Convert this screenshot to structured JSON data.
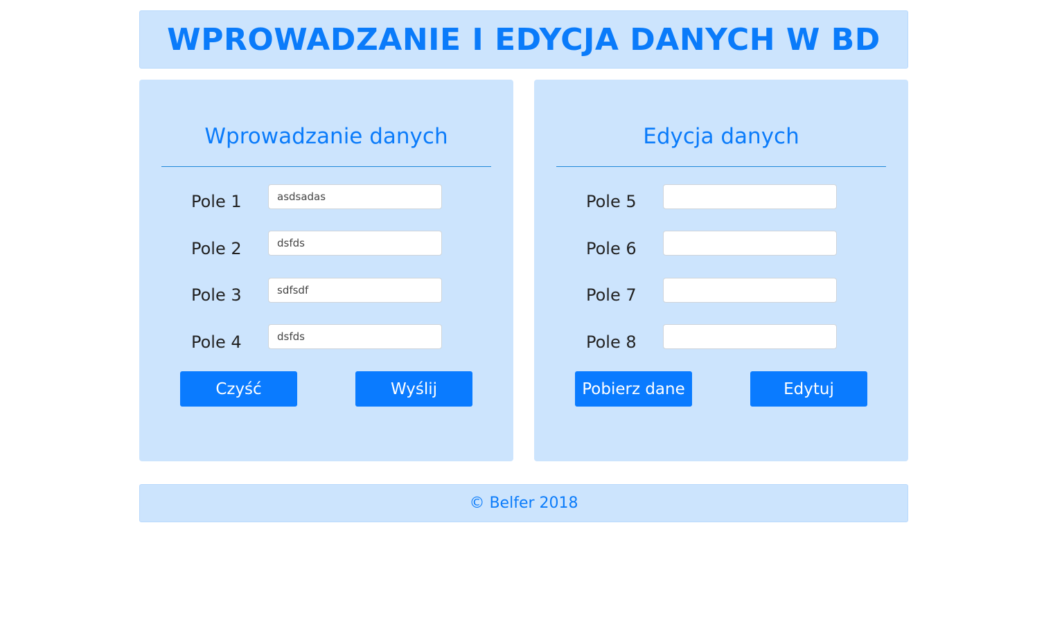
{
  "header": {
    "title": "WPROWADZANIE I EDYCJA DANYCH W BD"
  },
  "left_panel": {
    "title": "Wprowadzanie danych",
    "fields": [
      {
        "label": "Pole 1",
        "value": "asdsadas"
      },
      {
        "label": "Pole 2",
        "value": "dsfds"
      },
      {
        "label": "Pole 3",
        "value": "sdfsdf"
      },
      {
        "label": "Pole 4",
        "value": "dsfds"
      }
    ],
    "buttons": {
      "clear_label": "Czyść",
      "send_label": "Wyślij"
    }
  },
  "right_panel": {
    "title": "Edycja danych",
    "fields": [
      {
        "label": "Pole 5",
        "value": ""
      },
      {
        "label": "Pole 6",
        "value": ""
      },
      {
        "label": "Pole 7",
        "value": ""
      },
      {
        "label": "Pole 8",
        "value": ""
      }
    ],
    "buttons": {
      "fetch_label": "Pobierz dane",
      "edit_label": "Edytuj"
    }
  },
  "footer": {
    "text": "© Belfer 2018"
  },
  "colors": {
    "accent": "#0a7bff",
    "panel_bg": "#cce4fd",
    "title_text": "#0a7bfa"
  }
}
